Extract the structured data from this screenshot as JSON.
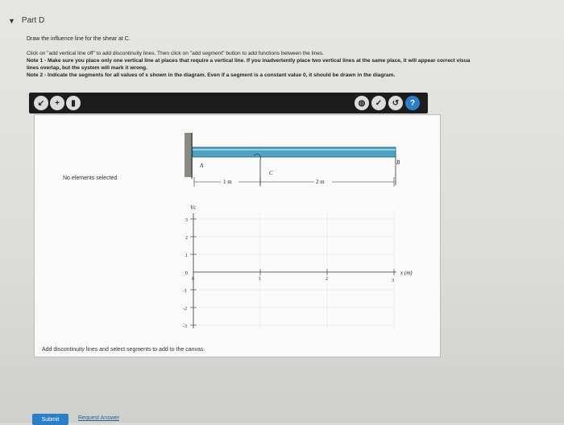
{
  "part": {
    "title": "Part D"
  },
  "instructions": {
    "question": "Draw the influence line for the shear at C.",
    "line1": "Click on \"add vertical line off\" to add discontinuity lines. Then click on \"add segment\" button to add functions between the lines.",
    "note1": "Note 1 - Make sure you place only one vertical line at places that require a vertical line. If you inadvertently place two vertical lines at the same place, it will appear correct visua",
    "note1b": "lines overlap, but the system will mark it wrong.",
    "note2": "Note 2 - Indicate the segments for all values of x shown in the diagram. Even if a segment is a constant value 0, it should be drawn in the diagram."
  },
  "toolbar": {
    "left_icons": [
      "vertical-line-icon",
      "add-icon",
      "trash-icon"
    ],
    "right_icons": [
      "hint-icon",
      "check-icon",
      "undo-icon",
      "help-icon"
    ],
    "help_label": "?"
  },
  "canvas": {
    "sidebar_text": "No elements selected",
    "hint": "Add discontinuity lines and select segments to add to the canvas."
  },
  "beam": {
    "point_a": "A",
    "point_b": "B",
    "point_c": "C",
    "dim1": "1 m",
    "dim2": "2 m"
  },
  "graph": {
    "ylabel": "Vc",
    "xlabel": "x (m)",
    "y_ticks": [
      "3",
      "2",
      "1",
      "0",
      "-1",
      "-2",
      "-3"
    ],
    "x_ticks": [
      "0",
      "1",
      "2",
      "3"
    ]
  },
  "footer": {
    "submit": "Submit",
    "request": "Request Answer"
  }
}
